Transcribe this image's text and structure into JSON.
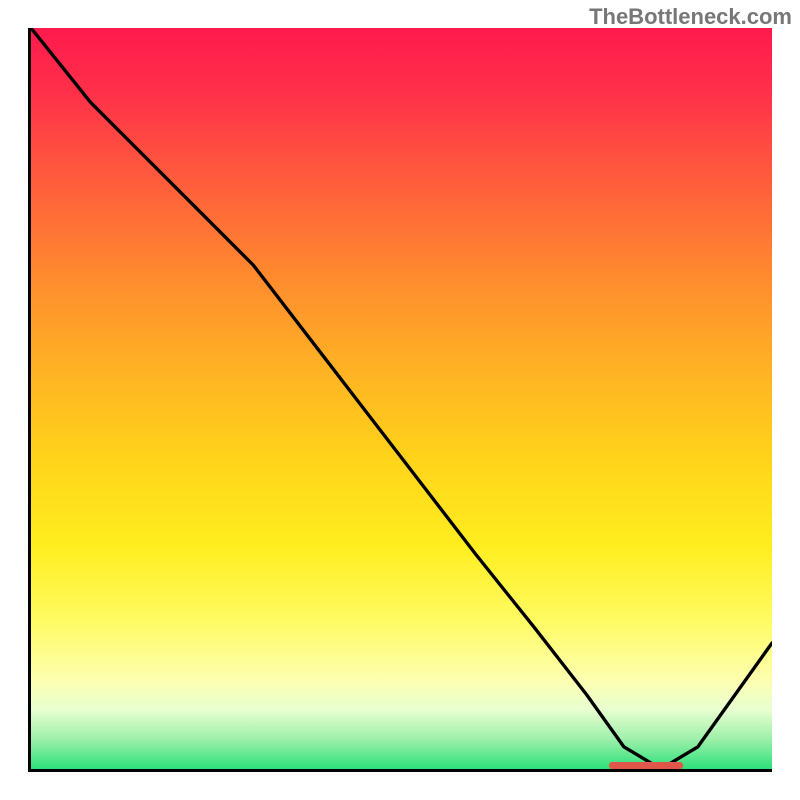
{
  "watermark": "TheBottleneck.com",
  "chart_data": {
    "type": "line",
    "title": "",
    "xlabel": "",
    "ylabel": "",
    "xlim": [
      0,
      100
    ],
    "ylim": [
      0,
      100
    ],
    "grid": false,
    "legend": false,
    "annotations": [],
    "series": [
      {
        "name": "curve",
        "x": [
          0,
          8,
          22,
          30,
          40,
          50,
          60,
          68,
          75,
          80,
          85,
          90,
          100
        ],
        "values": [
          100,
          90,
          76,
          68,
          55,
          42,
          29,
          19,
          10,
          3,
          0,
          3,
          17
        ]
      }
    ],
    "optimal_marker": {
      "x_start": 78,
      "x_end": 88,
      "y": 0
    },
    "background_gradient": {
      "top": "#ff1a4d",
      "mid": "#ffd31a",
      "low": "#fdffb0",
      "bottom": "#2de07a"
    }
  }
}
